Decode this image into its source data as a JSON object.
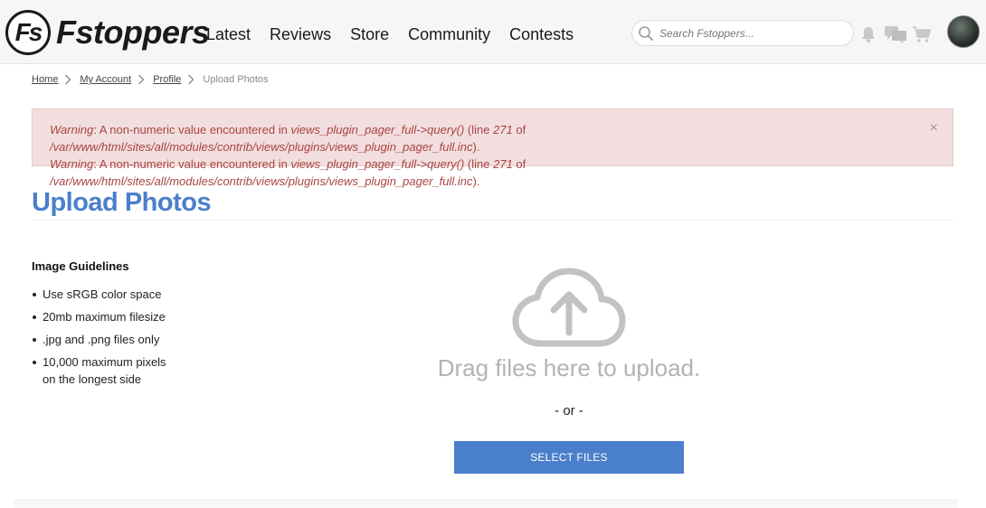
{
  "header": {
    "logo_mark": "Fs",
    "logo_text": "Fstoppers",
    "nav": [
      "Latest",
      "Reviews",
      "Store",
      "Community",
      "Contests"
    ],
    "search_placeholder": "Search Fstoppers..."
  },
  "breadcrumb": {
    "items": [
      "Home",
      "My Account",
      "Profile"
    ],
    "current": "Upload Photos"
  },
  "alert": {
    "lines": [
      {
        "label": "Warning",
        "text_a": ": A non-numeric value encountered in ",
        "func": "views_plugin_pager_full->query()",
        "text_b": " (line ",
        "line": "271",
        "text_c": " of ",
        "path": "/var/www/html/sites/all/modules/contrib/views/plugins/views_plugin_pager_full.inc",
        "text_d": ")."
      },
      {
        "label": "Warning",
        "text_a": ": A non-numeric value encountered in ",
        "func": "views_plugin_pager_full->query()",
        "text_b": " (line ",
        "line": "271",
        "text_c": " of ",
        "path": "/var/www/html/sites/all/modules/contrib/views/plugins/views_plugin_pager_full.inc",
        "text_d": ")."
      }
    ],
    "close": "×"
  },
  "page": {
    "title": "Upload Photos"
  },
  "guidelines": {
    "heading": "Image Guidelines",
    "items": [
      "Use sRGB color space",
      "20mb maximum filesize",
      ".jpg and .png files only",
      "10,000 maximum pixels on the longest side"
    ]
  },
  "upload": {
    "drag_text": "Drag files here to upload.",
    "or_text": "- or -",
    "button_label": "SELECT FILES"
  },
  "colors": {
    "accent": "#4a7fcb",
    "alert_bg": "#f2dede",
    "alert_text": "#a94442"
  },
  "icons": {
    "search": "search-icon",
    "bell": "bell-icon",
    "chat": "chat-icon",
    "cart": "cart-icon",
    "upload": "cloud-upload-icon",
    "chevron": "chevron-right-icon"
  }
}
